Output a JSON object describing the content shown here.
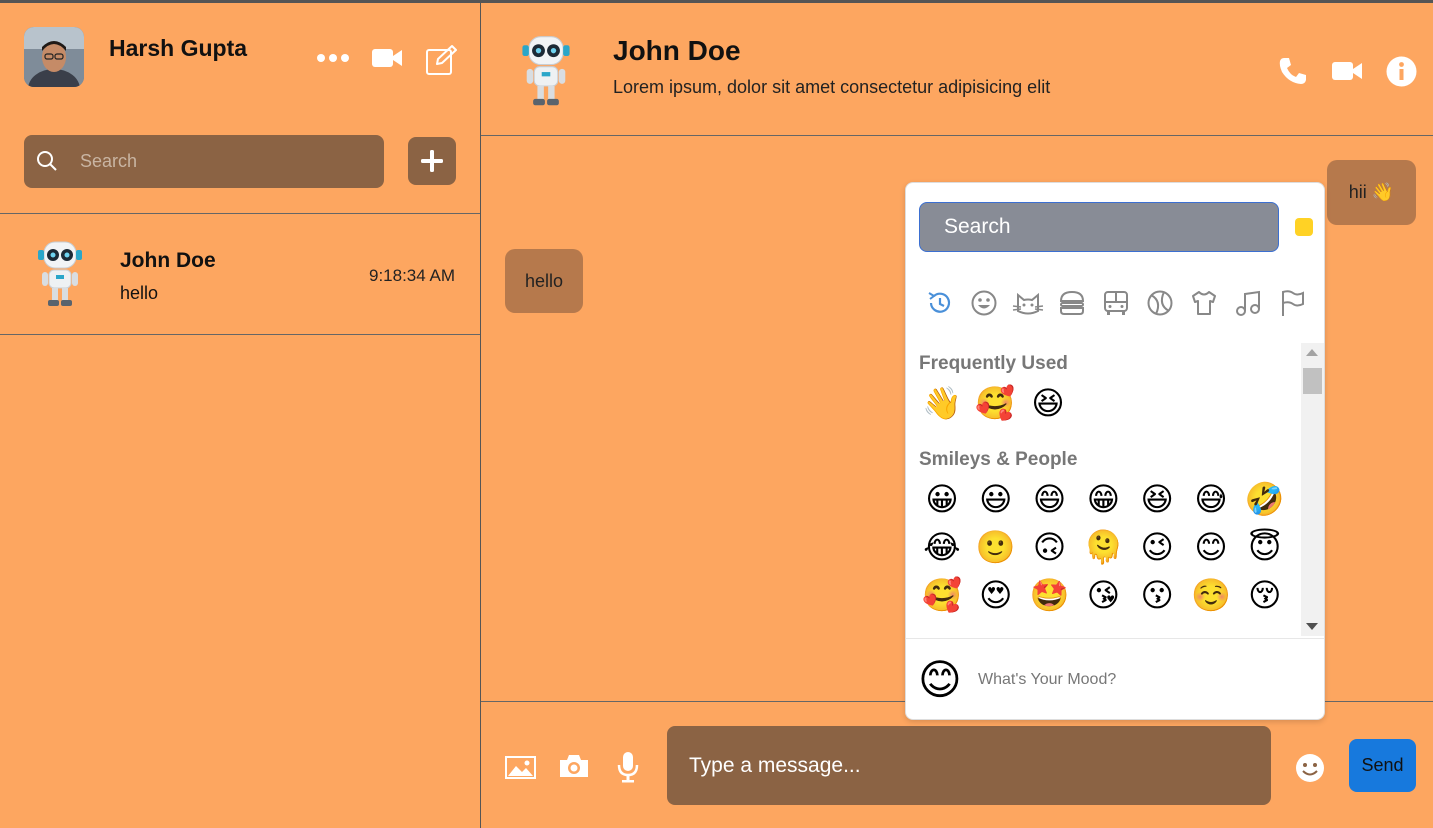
{
  "sidebar": {
    "user_name": "Harsh Gupta",
    "search_placeholder": "Search",
    "contacts": [
      {
        "name": "John Doe",
        "last_message": "hello",
        "time": "9:18:34 AM"
      }
    ]
  },
  "chat": {
    "contact_name": "John Doe",
    "contact_status": "Lorem ipsum, dolor sit amet consectetur adipisicing elit",
    "messages": [
      {
        "text": "hii 👋",
        "direction": "sent"
      },
      {
        "text": "hello",
        "direction": "received"
      }
    ],
    "composer_placeholder": "Type a message...",
    "send_label": "Send"
  },
  "emoji_picker": {
    "search_placeholder": "Search",
    "skin_tone_color": "#FFD225",
    "categories": [
      "recent-icon",
      "smiley-icon",
      "cat-icon",
      "burger-icon",
      "bus-icon",
      "ball-icon",
      "shirt-icon",
      "music-icon",
      "flag-icon"
    ],
    "frequently_used_title": "Frequently Used",
    "frequently_used": [
      "👋",
      "🥰",
      "😆"
    ],
    "smileys_title": "Smileys & People",
    "smileys": [
      "😀",
      "😃",
      "😄",
      "😁",
      "😆",
      "😅",
      "🤣",
      "😂",
      "🙂",
      "🙃",
      "🫠",
      "😉",
      "😊",
      "😇",
      "🥰",
      "😍",
      "🤩",
      "😘",
      "😗",
      "☺️",
      "😚"
    ],
    "mood_emoji": "😊",
    "mood_text": "What's Your Mood?"
  },
  "colors": {
    "background": "#FDA660",
    "panel": "#8B6344",
    "bubble": "#B6794C",
    "send": "#1779DD"
  }
}
